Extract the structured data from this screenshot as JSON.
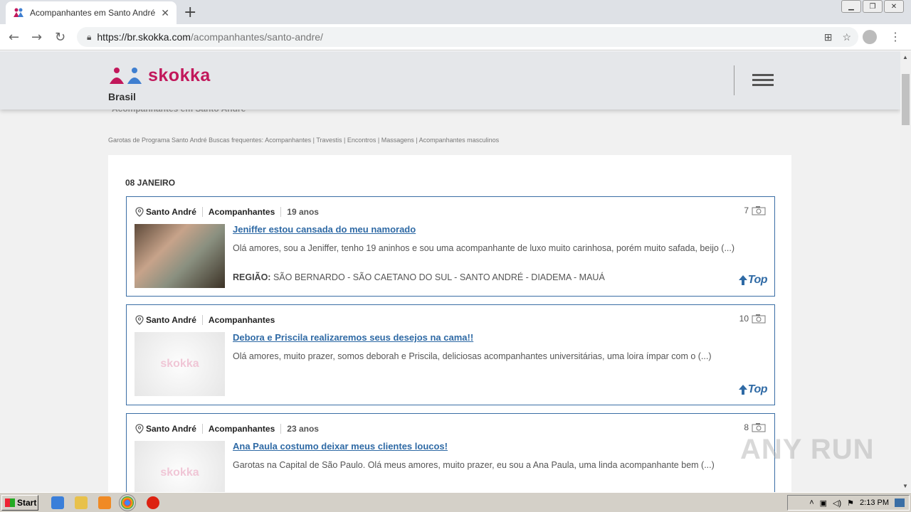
{
  "browser": {
    "tab_title": "Acompanhantes em Santo André e g",
    "url_host": "https://br.skokka.com",
    "url_path": "/acompanhantes/santo-andre/"
  },
  "header": {
    "logo_text": "skokka",
    "country": "Brasil",
    "ghost_title": "Acompanhantes em Santo André"
  },
  "frequent_searches": "Garotas de Programa Santo André  Buscas frequentes: Acompanhantes | Travestis | Encontros | Massagens | Acompanhantes masculinos",
  "date_heading": "08 JANEIRO",
  "placeholder_logo": "skokka",
  "top_label": "Top",
  "listings": [
    {
      "city": "Santo André",
      "category": "Acompanhantes",
      "age": "19 anos",
      "photos": "7",
      "title": "Jeniffer estou cansada do meu namorado",
      "description": "Olá amores, sou a Jeniffer, tenho 19 aninhos e sou uma acompanhante de luxo muito carinhosa, porém muito safada, beijo (...)",
      "region_label": "REGIÃO:",
      "region": "SÃO BERNARDO - SÃO CAETANO DO SUL - SANTO ANDRÉ - DIADEMA - MAUÁ"
    },
    {
      "city": "Santo André",
      "category": "Acompanhantes",
      "photos": "10",
      "title": "Debora e Priscila realizaremos seus desejos na cama!!",
      "description": "Olá amores, muito prazer, somos deborah e Priscila, deliciosas acompanhantes universitárias, uma loira ímpar com o (...)"
    },
    {
      "city": "Santo André",
      "category": "Acompanhantes",
      "age": "23 anos",
      "photos": "8",
      "title": "Ana Paula costumo deixar meus clientes loucos!",
      "description": "Garotas na Capital de São Paulo. Olá meus amores, muito prazer, eu sou a Ana Paula, uma linda acompanhante bem (...)"
    }
  ],
  "watermark": "ANY RUN",
  "taskbar": {
    "start_label": "Start",
    "clock": "2:13 PM"
  },
  "colors": {
    "brand": "#c2185b",
    "link": "#2f6aa5"
  }
}
